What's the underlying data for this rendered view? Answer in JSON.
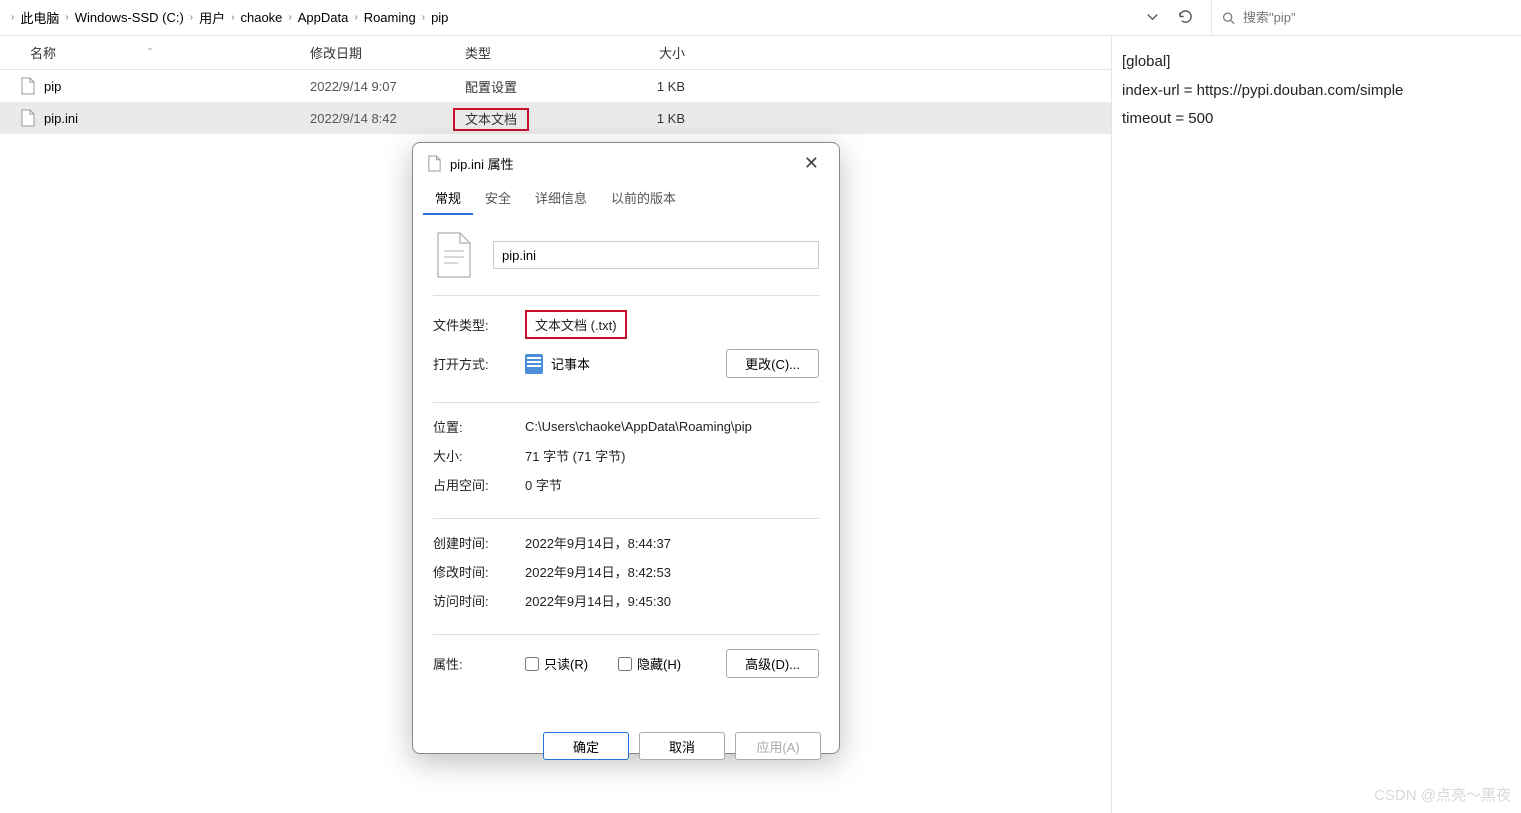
{
  "breadcrumb": [
    "此电脑",
    "Windows-SSD (C:)",
    "用户",
    "chaoke",
    "AppData",
    "Roaming",
    "pip"
  ],
  "search": {
    "placeholder": "搜索\"pip\""
  },
  "columns": {
    "name": "名称",
    "date": "修改日期",
    "type": "类型",
    "size": "大小"
  },
  "files": [
    {
      "name": "pip",
      "date": "2022/9/14 9:07",
      "type": "配置设置",
      "size": "1 KB"
    },
    {
      "name": "pip.ini",
      "date": "2022/9/14 8:42",
      "type": "文本文档",
      "size": "1 KB"
    }
  ],
  "preview": {
    "line1": "[global]",
    "line2": "index-url = https://pypi.douban.com/simple",
    "line3": "timeout = 500"
  },
  "dialog": {
    "title": "pip.ini 属性",
    "tabs": {
      "general": "常规",
      "security": "安全",
      "details": "详细信息",
      "previous": "以前的版本"
    },
    "filename": "pip.ini",
    "labels": {
      "filetype": "文件类型:",
      "openwith": "打开方式:",
      "location": "位置:",
      "size": "大小:",
      "sizeondisk": "占用空间:",
      "created": "创建时间:",
      "modified": "修改时间:",
      "accessed": "访问时间:",
      "attributes": "属性:"
    },
    "values": {
      "filetype": "文本文档 (.txt)",
      "openwith": "记事本",
      "change_btn": "更改(C)...",
      "location": "C:\\Users\\chaoke\\AppData\\Roaming\\pip",
      "size": "71 字节 (71 字节)",
      "sizeondisk": "0 字节",
      "created": "2022年9月14日，8:44:37",
      "modified": "2022年9月14日，8:42:53",
      "accessed": "2022年9月14日，9:45:30",
      "readonly": "只读(R)",
      "hidden": "隐藏(H)",
      "advanced": "高级(D)..."
    },
    "buttons": {
      "ok": "确定",
      "cancel": "取消",
      "apply": "应用(A)"
    }
  },
  "watermark": "CSDN @点亮～黑夜"
}
